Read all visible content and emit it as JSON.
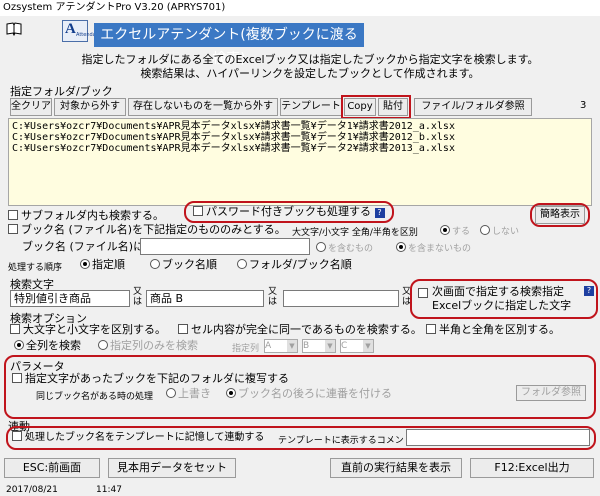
{
  "app": {
    "title": "Ozsystem アテンダントPro V3.20 (APRYS701)",
    "banner": "エクセルアテンダント(複数ブックに渡る検索)",
    "icon_letter": "A",
    "icon_sub": "Attendant"
  },
  "description": [
    "指定したフォルダにある全てのExcelブック又は指定したブックから指定文字を検索します。",
    "検索結果は、ハイパーリンクを設定したブックとして作成されます。"
  ],
  "folder": {
    "header": "指定フォルダ/ブック",
    "clear": "全クリア",
    "remove": "対象から外す",
    "list_missing": "存在しないものを一覧から外す",
    "template": "テンプレート",
    "copy": "Copy",
    "paste": "貼付",
    "browse": "ファイル/フォルダ参照",
    "count": "3",
    "files": [
      "C:¥Users¥ozcr7¥Documents¥APR見本データxlsx¥請求書一覧¥データ1¥請求書2012_a.xlsx",
      "C:¥Users¥ozcr7¥Documents¥APR見本データxlsx¥請求書一覧¥データ1¥請求書2012_b.xlsx",
      "C:¥Users¥ozcr7¥Documents¥APR見本データxlsx¥請求書一覧¥データ2¥請求書2013_a.xlsx"
    ]
  },
  "options": {
    "subfolder": "サブフォルダ内も検索する。",
    "password": "パスワード付きブックも処理する",
    "simple_view": "簡略表示",
    "bookname_filter": "ブック名 (ファイル名)を下記指定のもののみとする。",
    "case_sensitive_label": "大文字/小文字 全角/半角を区別",
    "case_yes": "する",
    "case_no": "しない",
    "bookname_label": "ブック名 (ファイル名)に",
    "contains": "を含むもの",
    "not_contains": "を含まないもの",
    "order_label": "処理する順序",
    "order_specified": "指定順",
    "order_book": "ブック名順",
    "order_folder": "フォルダ/ブック名順"
  },
  "search": {
    "header": "検索文字",
    "term1": "特別値引き商品",
    "or1": "又は",
    "term2": "商品 B",
    "or2": "又は",
    "term3": "",
    "or3": "又は",
    "next_screen": "次画面で指定する検索指定",
    "next_screen2": "Excelブックに指定した文字"
  },
  "search_options": {
    "header": "検索オプション",
    "case": "大文字と小文字を区別する。",
    "exact": "セル内容が完全に同一であるものを検索する。",
    "width": "半角と全角を区別する。",
    "all_columns": "全列を検索",
    "specified_columns": "指定列のみを検索",
    "column_label": "指定列",
    "col1": "A",
    "col2": "B",
    "col3": "C"
  },
  "params": {
    "header": "パラメータ",
    "copy_books": "指定文字があったブックを下記のフォルダに複写する",
    "same_name_label": "同じブック名がある時の処理",
    "overwrite": "上書き",
    "append_serial": "ブック名の後ろに連番を付ける",
    "folder_browse": "フォルダ参照"
  },
  "link": {
    "header": "連動",
    "record": "処理したブック名をテンプレートに記憶して連動する",
    "comment_label": "テンプレートに表示するコメント",
    "comment": ""
  },
  "footer": {
    "esc": "ESC:前画面",
    "sample": "見本用データをセット",
    "prev_result": "直前の実行結果を表示",
    "f12": "F12:Excel出力"
  },
  "status": {
    "date": "2017/08/21",
    "time": "11:47"
  }
}
